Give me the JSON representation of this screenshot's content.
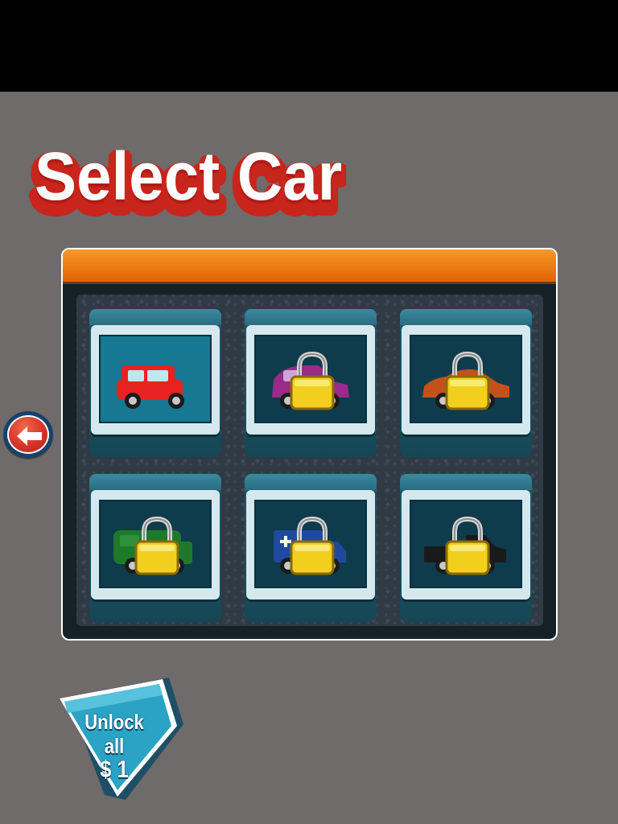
{
  "screen": {
    "title": "Select Car"
  },
  "nav": {
    "back_icon": "arrow-left-icon"
  },
  "cars": [
    {
      "name": "red-jeep",
      "color": "#e8221f",
      "locked": false,
      "kind": "jeep"
    },
    {
      "name": "purple-car",
      "color": "#9b2a8a",
      "locked": true,
      "kind": "hatch"
    },
    {
      "name": "orange-sports-car",
      "color": "#c4511a",
      "locked": true,
      "kind": "sports"
    },
    {
      "name": "green-van",
      "color": "#1e7a2a",
      "locked": true,
      "kind": "van"
    },
    {
      "name": "blue-ambulance",
      "color": "#1f4aa0",
      "locked": true,
      "kind": "ambulance"
    },
    {
      "name": "black-pickup",
      "color": "#1a1a1a",
      "locked": true,
      "kind": "pickup"
    }
  ],
  "unlock": {
    "line1": "Unlock all",
    "line2": "$ 1"
  },
  "colors": {
    "background": "#6f6b6a",
    "header_orange": "#ef7f16",
    "slot_teal": "#2b6b80",
    "lock_gold": "#f2cf1d"
  }
}
